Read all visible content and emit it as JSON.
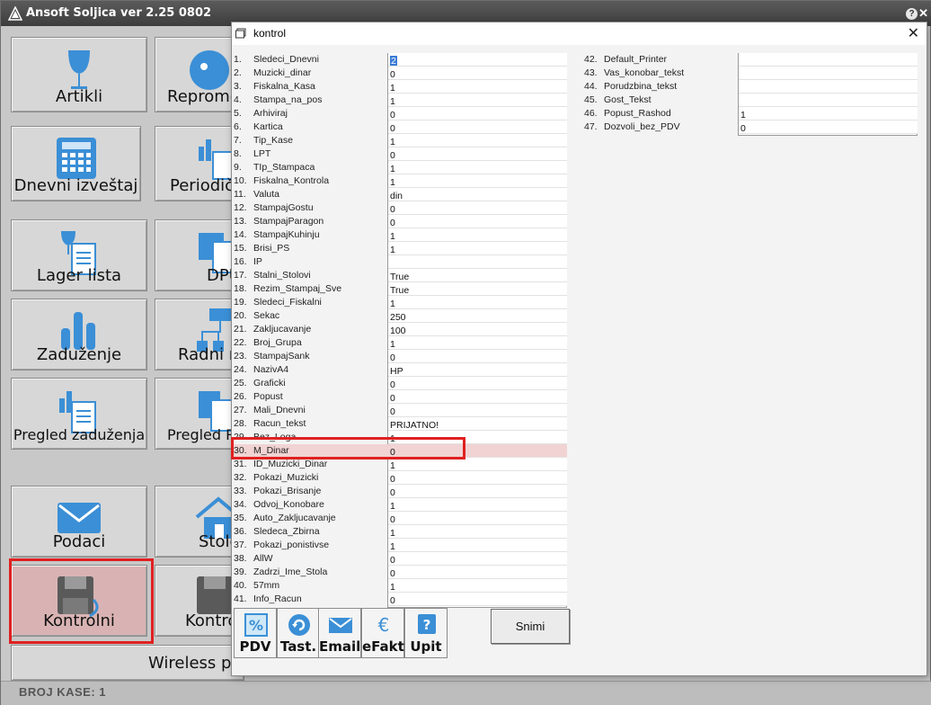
{
  "app": {
    "title": "Ansoft Soljica ver 2.25 0802",
    "help": "?",
    "close": "✕",
    "status": "BROJ KASE: 1",
    "tiles": [
      {
        "label": "Artikli",
        "icon": "stemware-icon"
      },
      {
        "label": "Repromo",
        "icon": "fish-icon"
      },
      {
        "label": "Dnevni izveštaj",
        "icon": "calculator-icon"
      },
      {
        "label": "Periodič",
        "icon": "chart-doc-icon"
      },
      {
        "label": "Lager lista",
        "icon": "glass-doc-icon"
      },
      {
        "label": "DPU",
        "icon": "calc-doc-icon"
      },
      {
        "label": "Zaduženje",
        "icon": "bar-chart-icon"
      },
      {
        "label": "Radni r",
        "icon": "hierarchy-icon"
      },
      {
        "label": "Pregled zaduženja",
        "icon": "chart-doc-icon"
      },
      {
        "label": "Pregled RN",
        "icon": "docs-icon"
      },
      {
        "label": "Podaci",
        "icon": "envelope-icon"
      },
      {
        "label": "Stolo",
        "icon": "house-icon"
      },
      {
        "label": "Kontrolni",
        "icon": "floppy-icon"
      },
      {
        "label": "Kontro",
        "icon": "floppy-icon"
      },
      {
        "label": "Wireless pa",
        "icon": ""
      }
    ]
  },
  "dialog": {
    "title": "kontrol",
    "close": "✕",
    "left_params": [
      {
        "num": "1.",
        "name": "Sledeci_Dnevni",
        "value": "2"
      },
      {
        "num": "2.",
        "name": "Muzicki_dinar",
        "value": "0"
      },
      {
        "num": "3.",
        "name": "Fiskalna_Kasa",
        "value": "1"
      },
      {
        "num": "4.",
        "name": "Stampa_na_pos",
        "value": "1"
      },
      {
        "num": "5.",
        "name": "Arhiviraj",
        "value": "0"
      },
      {
        "num": "6.",
        "name": "Kartica",
        "value": "0"
      },
      {
        "num": "7.",
        "name": "Tip_Kase",
        "value": "1"
      },
      {
        "num": "8.",
        "name": "LPT",
        "value": "0"
      },
      {
        "num": "9.",
        "name": "TIp_Stampaca",
        "value": "1"
      },
      {
        "num": "10.",
        "name": "Fiskalna_Kontrola",
        "value": "1"
      },
      {
        "num": "11.",
        "name": "Valuta",
        "value": "din"
      },
      {
        "num": "12.",
        "name": "StampajGostu",
        "value": "0"
      },
      {
        "num": "13.",
        "name": "StampajParagon",
        "value": "0"
      },
      {
        "num": "14.",
        "name": "StampajKuhinju",
        "value": "1"
      },
      {
        "num": "15.",
        "name": "Brisi_PS",
        "value": "1"
      },
      {
        "num": "16.",
        "name": "IP",
        "value": ""
      },
      {
        "num": "17.",
        "name": "Stalni_Stolovi",
        "value": "True"
      },
      {
        "num": "18.",
        "name": "Rezim_Stampaj_Sve",
        "value": "True"
      },
      {
        "num": "19.",
        "name": "Sledeci_Fiskalni",
        "value": "1"
      },
      {
        "num": "20.",
        "name": "Sekac",
        "value": "250"
      },
      {
        "num": "21.",
        "name": "Zakljucavanje",
        "value": "100"
      },
      {
        "num": "22.",
        "name": "Broj_Grupa",
        "value": "1"
      },
      {
        "num": "23.",
        "name": "StampajSank",
        "value": "0"
      },
      {
        "num": "24.",
        "name": "NazivA4",
        "value": "HP"
      },
      {
        "num": "25.",
        "name": "Graficki",
        "value": "0"
      },
      {
        "num": "26.",
        "name": "Popust",
        "value": "0"
      },
      {
        "num": "27.",
        "name": "Mali_Dnevni",
        "value": "0"
      },
      {
        "num": "28.",
        "name": "Racun_tekst",
        "value": "PRIJATNO!"
      },
      {
        "num": "29.",
        "name": "Bez_Loga",
        "value": "1"
      },
      {
        "num": "30.",
        "name": "M_Dinar",
        "value": "0"
      },
      {
        "num": "31.",
        "name": "ID_Muzicki_Dinar",
        "value": "1"
      },
      {
        "num": "32.",
        "name": "Pokazi_Muzicki",
        "value": "0"
      },
      {
        "num": "33.",
        "name": "Pokazi_Brisanje",
        "value": "0"
      },
      {
        "num": "34.",
        "name": "Odvoj_Konobare",
        "value": "1"
      },
      {
        "num": "35.",
        "name": "Auto_Zakljucavanje",
        "value": "0"
      },
      {
        "num": "36.",
        "name": "Sledeca_Zbirna",
        "value": "1"
      },
      {
        "num": "37.",
        "name": "Pokazi_ponistivse",
        "value": "1"
      },
      {
        "num": "38.",
        "name": "AllW",
        "value": "0"
      },
      {
        "num": "39.",
        "name": "Zadrzi_Ime_Stola",
        "value": "0"
      },
      {
        "num": "40.",
        "name": "57mm",
        "value": "1"
      },
      {
        "num": "41.",
        "name": "Info_Racun",
        "value": "0"
      }
    ],
    "right_params": [
      {
        "num": "42.",
        "name": "Default_Printer",
        "value": ""
      },
      {
        "num": "43.",
        "name": "Vas_konobar_tekst",
        "value": ""
      },
      {
        "num": "44.",
        "name": "Porudzbina_tekst",
        "value": ""
      },
      {
        "num": "45.",
        "name": "Gost_Tekst",
        "value": ""
      },
      {
        "num": "46.",
        "name": "Popust_Rashod",
        "value": "1"
      },
      {
        "num": "47.",
        "name": "Dozvoli_bez_PDV",
        "value": "0"
      }
    ],
    "toolbar": [
      {
        "label": "PDV",
        "icon": "percent-icon"
      },
      {
        "label": "Tast.",
        "icon": "refresh-icon"
      },
      {
        "label": "Email",
        "icon": "mail-icon"
      },
      {
        "label": "eFakt",
        "icon": "euro-icon"
      },
      {
        "label": "Upit",
        "icon": "question-icon"
      }
    ],
    "save_label": "Snimi"
  },
  "colors": {
    "highlight": "#e02020",
    "accent": "#3b8fd6"
  }
}
